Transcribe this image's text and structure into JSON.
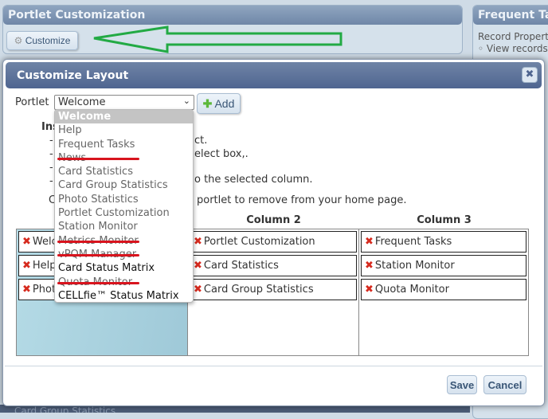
{
  "background": {
    "portlet_panel": {
      "title": "Portlet Customization",
      "customize_label": "Customize"
    },
    "frequent_panel": {
      "title": "Frequent Tas",
      "line1": "Record Properti",
      "item1": "View records"
    },
    "bottom_strip": "Card Group Statistics"
  },
  "dialog": {
    "title": "Customize Layout",
    "close_icon": "close-icon",
    "portlet_label": "Portlet",
    "portlet_value": "Welcome",
    "add_label": "Add",
    "dropdown_options": [
      {
        "label": "Welcome",
        "state": "selected"
      },
      {
        "label": "Help",
        "state": "added"
      },
      {
        "label": "Frequent Tasks",
        "state": "added"
      },
      {
        "label": "News",
        "state": "struck"
      },
      {
        "label": "Card Statistics",
        "state": "added"
      },
      {
        "label": "Card Group Statistics",
        "state": "added"
      },
      {
        "label": "Photo Statistics",
        "state": "added"
      },
      {
        "label": "Portlet Customization",
        "state": "added"
      },
      {
        "label": "Station Monitor",
        "state": "added"
      },
      {
        "label": "Metrics Monitor",
        "state": "struck"
      },
      {
        "label": "vPQM Manager",
        "state": "struck"
      },
      {
        "label": "Card Status Matrix",
        "state": "available"
      },
      {
        "label": "Quota Monitor",
        "state": "struck"
      },
      {
        "label": "CELLfie™ Status Matrix",
        "state": "available"
      }
    ],
    "instructions": {
      "heading": "Ins",
      "l1": "ct.",
      "l2": "elect box,.",
      "l3": "o the selected column.",
      "l4_start": "C",
      "l4": "portlet to remove from your home page."
    },
    "columns": [
      {
        "header": "",
        "items": [
          "Welcome",
          "Help",
          "Photo Statistics"
        ]
      },
      {
        "header": "Column 2",
        "items": [
          "Portlet Customization",
          "Card Statistics",
          "Card Group Statistics"
        ]
      },
      {
        "header": "Column 3",
        "items": [
          "Frequent Tasks",
          "Station Monitor",
          "Quota Monitor"
        ]
      }
    ],
    "save_label": "Save",
    "cancel_label": "Cancel"
  },
  "colors": {
    "header": "#5a6f97",
    "remove": "#d62a1e",
    "strike": "#d8141e",
    "arrow": "#22aa44",
    "column1_bg": "#a9d3e0"
  }
}
